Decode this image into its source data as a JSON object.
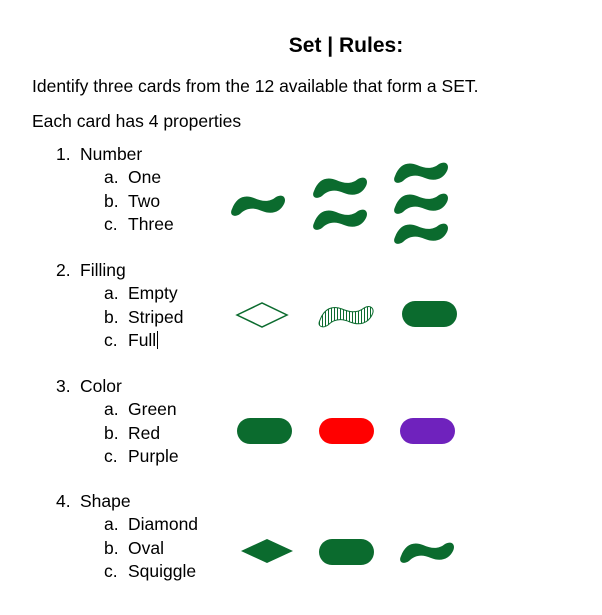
{
  "title": "Set | Rules:",
  "intro": "Identify three cards from the 12 available that form a SET.",
  "properties_intro": "Each card has 4 properties",
  "properties": [
    {
      "number": "1.",
      "name": "Number",
      "options": [
        {
          "letter": "a.",
          "label": "One"
        },
        {
          "letter": "b.",
          "label": "Two"
        },
        {
          "letter": "c.",
          "label": "Three"
        }
      ]
    },
    {
      "number": "2.",
      "name": "Filling",
      "options": [
        {
          "letter": "a.",
          "label": "Empty"
        },
        {
          "letter": "b.",
          "label": "Striped"
        },
        {
          "letter": "c.",
          "label": "Full"
        }
      ]
    },
    {
      "number": "3.",
      "name": "Color",
      "options": [
        {
          "letter": "a.",
          "label": "Green"
        },
        {
          "letter": "b.",
          "label": "Red"
        },
        {
          "letter": "c.",
          "label": "Purple"
        }
      ]
    },
    {
      "number": "4.",
      "name": "Shape",
      "options": [
        {
          "letter": "a.",
          "label": "Diamond"
        },
        {
          "letter": "b.",
          "label": "Oval"
        },
        {
          "letter": "c.",
          "label": "Squiggle"
        }
      ]
    }
  ],
  "colors": {
    "green": "#0b6b2e",
    "red": "#ff0000",
    "purple": "#6f22bd"
  },
  "illustrations": {
    "number": [
      "one-squiggle-icon",
      "two-squiggles-icon",
      "three-squiggles-icon"
    ],
    "filling": [
      "empty-diamond-icon",
      "striped-squiggle-icon",
      "full-oval-icon"
    ],
    "color": [
      "green-oval-icon",
      "red-oval-icon",
      "purple-oval-icon"
    ],
    "shape": [
      "diamond-icon",
      "oval-icon",
      "squiggle-icon"
    ]
  }
}
